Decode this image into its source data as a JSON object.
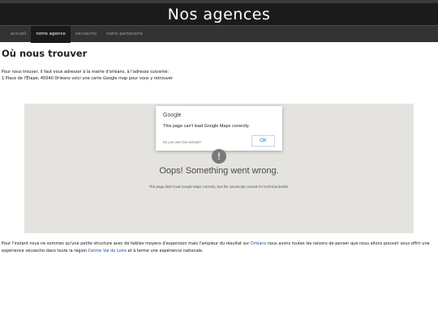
{
  "header": {
    "title": "Nos agences"
  },
  "nav": {
    "items": [
      {
        "label": "accueil",
        "active": false
      },
      {
        "label": "notre agence",
        "active": true
      },
      {
        "label": "vecoecho",
        "active": false
      },
      {
        "label": "notre partenaire",
        "active": false
      }
    ]
  },
  "main": {
    "heading": "Où nous trouver",
    "intro_line1": "Pour nous trouver, il faut vous adresser à la mairie d'orléans, à l'adresse suivante:",
    "intro_line2": "1 Place de l'Étape, 45040 Orléans voici une carte Google map pour vous y retrouver"
  },
  "map": {
    "dialog": {
      "brand": "Google",
      "message": "This page can't load Google Maps correctly.",
      "question": "Do you own this website?",
      "ok_label": "OK"
    },
    "warning_icon": "exclamation-icon",
    "error_title": "Oops! Something went wrong.",
    "error_detail": "This page didn't load Google Maps correctly. See the JavaScript console for technical details."
  },
  "outro": {
    "part1": "Pour l'instant nous ne sommes qu'une petite structure avec de faibles moyens d'expension mais l'ampleur du résultat sur ",
    "link_orleans": "Orléans",
    "part2": " nous avons toutes les raisons de penser que nous allons pouvoir vous offrir une expérience vécoecho dans toute la région ",
    "link_region": "Centre Val de Loire",
    "part3": " et à terme une expérience nationale."
  },
  "colors": {
    "banner_bg": "#1b1b1b",
    "nav_bg": "#333333",
    "map_bg": "#e5e3df",
    "link": "#1f4fa0",
    "ok_button": "#1a73e8"
  }
}
